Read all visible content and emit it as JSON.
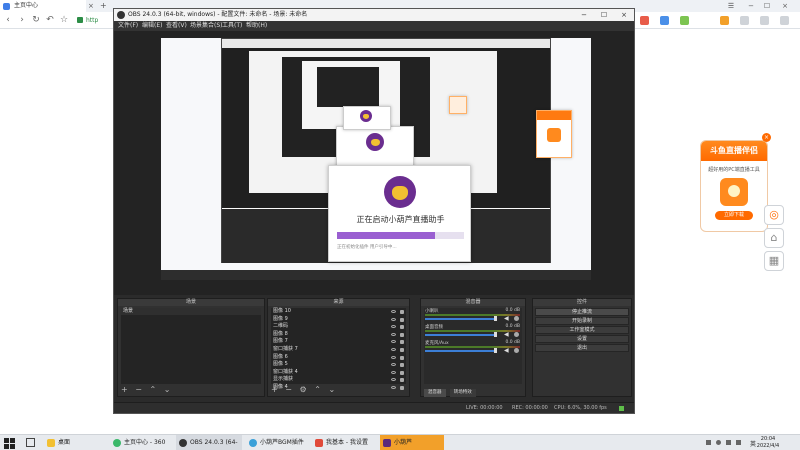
{
  "browser": {
    "tab": {
      "title": "主页中心"
    },
    "close_symbol": "×",
    "new_tab_symbol": "+",
    "address": "http",
    "window_controls": [
      "−",
      "☐",
      "×"
    ]
  },
  "obs": {
    "title": "OBS 24.0.3 (64-bit, windows) - 配置文件: 未命名 - 场景: 未命名",
    "menu": [
      "文件(F)",
      "编辑(E)",
      "查看(V)",
      "场景集合(S)",
      "工具(T)",
      "帮助(H)"
    ],
    "window_controls": [
      "−",
      "☐",
      "×"
    ],
    "docks": {
      "scenes": {
        "title": "场景",
        "items": [
          "场景"
        ]
      },
      "sources": {
        "title": "来源",
        "items": [
          "图像 10",
          "图像 9",
          "二维码",
          "图像 8",
          "图像 7",
          "窗口捕获 7",
          "图像 6",
          "图像 5",
          "窗口捕获 4",
          "显示捕获",
          "图像 4"
        ]
      },
      "mixer": {
        "title": "混音器",
        "channels": [
          {
            "name": "小喇叭",
            "db": "0.0 dB"
          },
          {
            "name": "桌面音频",
            "db": "0.0 dB"
          },
          {
            "name": "麦克风/Aux",
            "db": "0.0 dB"
          }
        ],
        "tabs": [
          "混音器",
          "转场特效"
        ]
      },
      "controls": {
        "title": "控件",
        "buttons": [
          "停止推流",
          "开始录制",
          "工作室模式",
          "设置",
          "退出"
        ]
      }
    },
    "status": {
      "live": "LIVE: 00:00:00",
      "rec": "REC: 00:00:00",
      "cpu": "CPU: 6.0%, 30.00 fps"
    }
  },
  "splash": {
    "text": "正在启动小葫芦直播助手",
    "status": "正在初始化插件  用户引导中...",
    "progress": 0.77
  },
  "ad": {
    "title": "斗鱼直播伴侣",
    "desc": "超好用的PC端直播工具",
    "button": "立即下载",
    "close": "×"
  },
  "taskbar": {
    "items": [
      "桌面",
      "主页中心 - 360极...",
      "OBS 24.0.3 (64-bi...",
      "小葫芦BGM插件找...",
      "我基本 - 我设置",
      "小葫芦"
    ],
    "time": "20:04",
    "date": "2022/4/4",
    "lang": "英"
  }
}
